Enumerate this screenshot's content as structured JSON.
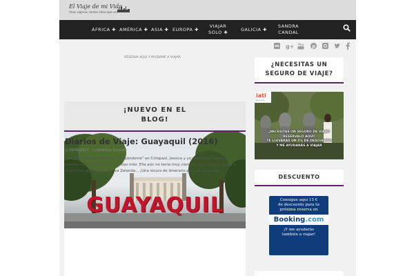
{
  "header": {
    "logo_title": "El Viaje de mi Vida",
    "logo_subtitle": "Unos viajeros, tantos sitios que ver"
  },
  "nav": {
    "items": [
      {
        "label": "ÁFRICA ✚"
      },
      {
        "label": "AMÉRICA ✚"
      },
      {
        "label": "ASIA ✚"
      },
      {
        "label": "EUROPA ✚"
      },
      {
        "label_line1": "VIAJAR",
        "label_line2": "SOLO ✚"
      },
      {
        "label": "GALICIA ✚"
      },
      {
        "label_line1": "SANDRA",
        "label_line2": "CANDAL"
      }
    ],
    "search_icon": "search-icon"
  },
  "social": [
    "flickr-icon",
    "google-plus-icon",
    "youtube-icon",
    "pinterest-icon",
    "instagram-icon",
    "twitter-icon",
    "facebook-icon"
  ],
  "main": {
    "topline": "RESERVA AQUÍ Y AYÚDAME A VIAJAR",
    "blog_heading_line1": "¡NUEVO EN EL",
    "blog_heading_line2": "BLOG!",
    "photo_sign": "GUAYAQUIL",
    "post": {
      "title": "Diarios de Viaje: Guayaquil (2016)",
      "date": "29/06/2017",
      "categories": "América, Ecuador",
      "excerpt": "Tras unos días meditando y \"relajándome\" en Cotopaxi, Jessica y yo decidimos seguir nuestro viaje juntas por unos días más. Ella aún no tenía muy claro su ruta. Viajaría luego a Argentina, enlazaría a Nueva Zelanda... ¡Una locura de itinerario para mí, aún más ..."
    }
  },
  "sidebar": {
    "insurance_title_line1": "¿NECESITAS UN",
    "insurance_title_line2": "SEGURO DE VIAJE?",
    "iati_brand": "iati",
    "iati_brand_sub": "Seguros",
    "iati_lines": [
      "¿NECESITAS UN SEGURO DE VIAJE?",
      "RESÉRVALO AQUÍ!",
      "TE LLEVARÁS UN 5% DE DESCUENTO",
      "Y ME AYUDARÁS A VIAJAR"
    ],
    "discount_title": "DESCUENTO",
    "booking_top_line1": "Consigue aquí 15 €",
    "booking_top_line2": "de descuento para tu",
    "booking_top_line3": "próxima reserva en",
    "booking_brand": "Booking",
    "booking_brand_suffix": ".com",
    "booking_bottom_line1": "¡Y me ayudarás",
    "booking_bottom_line2": "también a viajar!"
  },
  "colors": {
    "nav_bg": "#222222",
    "accent_purple": "#5b2163",
    "booking_blue": "#0f3c7a",
    "sign_red": "#c0152a"
  }
}
